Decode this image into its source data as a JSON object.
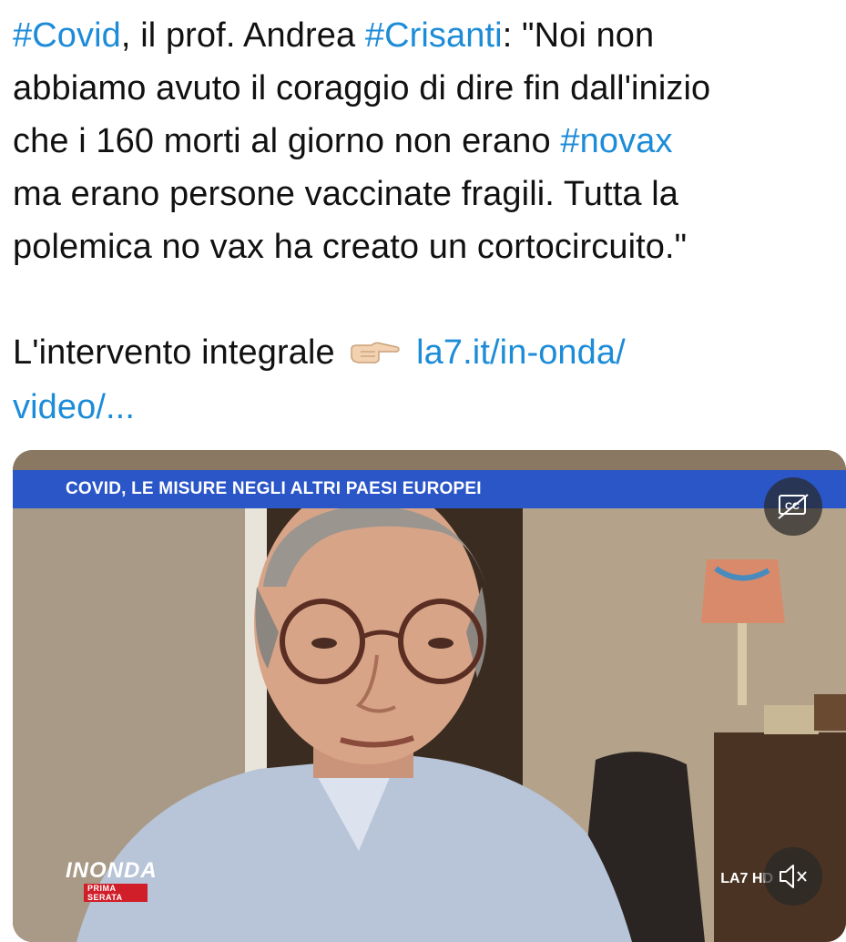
{
  "tweet": {
    "line1": {
      "hashtag1": "#Covid",
      "text1": ", il prof. Andrea ",
      "hashtag2": "#Crisanti",
      "text2": ": \"Noi non"
    },
    "line2": "abbiamo avuto il coraggio di dire fin dall'inizio",
    "line3": {
      "text": "che i 160 morti al giorno non erano ",
      "hashtag": "#novax"
    },
    "line4": "ma erano persone vaccinate fragili. Tutta la",
    "line5": "polemica no vax ha creato un cortocircuito.\"",
    "line6": {
      "text": "L'intervento integrale",
      "link": "la7.it/in-onda/"
    },
    "line7": {
      "link": "video/..."
    }
  },
  "video": {
    "banner": "COVID, LE MISURE NEGLI ALTRI PAESI EUROPEI",
    "show_logo": "INONDA",
    "show_logo_sub": "PRIMA SERATA",
    "channel_bug": "LA7 HD",
    "icons": [
      "closed-captions-icon",
      "volume-muted-icon",
      "pointing-hand-icon"
    ]
  },
  "colors": {
    "link": "#1d8cd8",
    "banner": "#2a56c8",
    "text": "#111111"
  }
}
